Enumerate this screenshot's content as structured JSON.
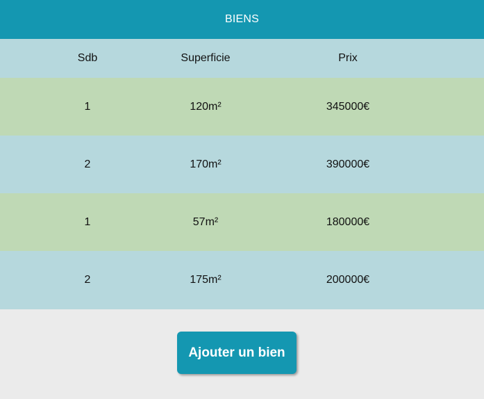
{
  "header": {
    "title": "BIENS"
  },
  "table": {
    "columns": [
      "Sdb",
      "Superficie",
      "Prix"
    ],
    "rows": [
      [
        "1",
        "120m²",
        "345000€"
      ],
      [
        "2",
        "170m²",
        "390000€"
      ],
      [
        "1",
        "57m²",
        "180000€"
      ],
      [
        "2",
        "175m²",
        "200000€"
      ]
    ]
  },
  "actions": {
    "add_label": "Ajouter un bien"
  },
  "colors": {
    "accent": "#1497b1",
    "row_blue": "#b6d8dd",
    "row_green": "#bfd9b5",
    "background": "#ebebeb"
  }
}
